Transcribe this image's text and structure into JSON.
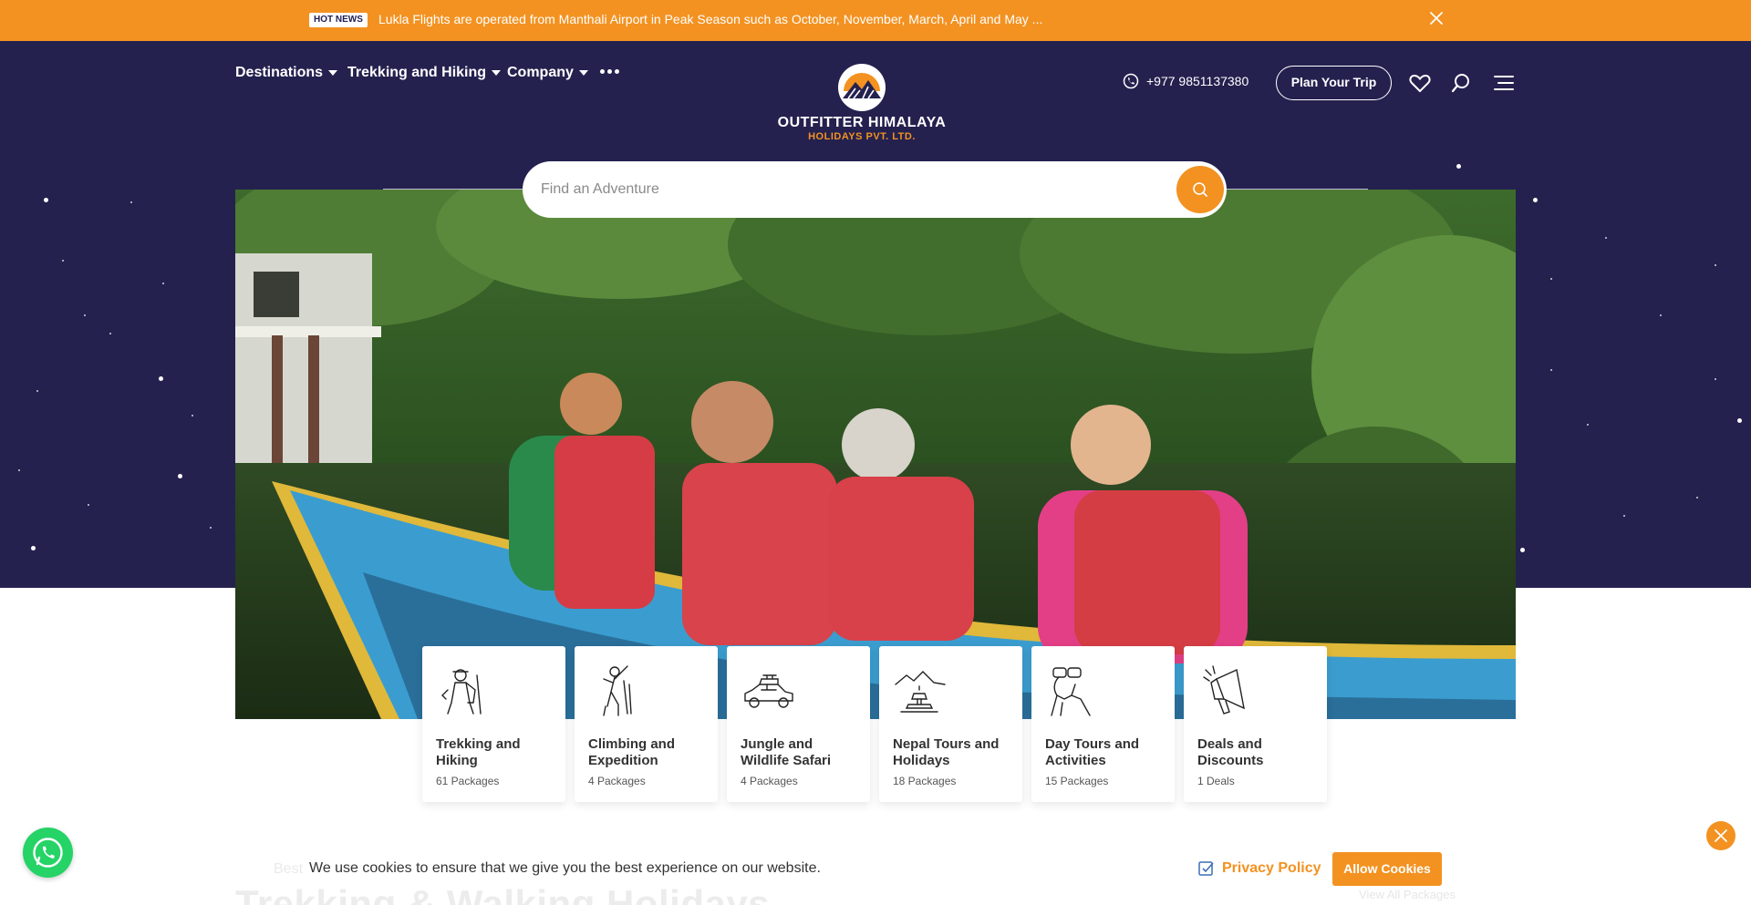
{
  "hot_news": {
    "badge": "HOT NEWS",
    "text": "Lukla Flights are operated from Manthali Airport in Peak Season such as October, November, March, April and May ..."
  },
  "nav": {
    "items": [
      {
        "label": "Destinations"
      },
      {
        "label": "Trekking and Hiking"
      },
      {
        "label": "Company"
      }
    ],
    "more_icon": "more-dots-icon"
  },
  "logo": {
    "name": "OUTFITTER HIMALAYA",
    "sub": "HOLIDAYS PVT. LTD."
  },
  "header": {
    "phone": "+977 9851137380",
    "plan_button": "Plan Your Trip",
    "icons": [
      "whatsapp-icon",
      "heart-icon",
      "search-icon",
      "menu-icon"
    ]
  },
  "search": {
    "placeholder": "Find an Adventure"
  },
  "categories": [
    {
      "title": "Trekking and Hiking",
      "count": "61 Packages",
      "icon": "trekker-icon"
    },
    {
      "title": "Climbing and Expedition",
      "count": "4 Packages",
      "icon": "climber-icon"
    },
    {
      "title": "Jungle and Wildlife Safari",
      "count": "4 Packages",
      "icon": "safari-jeep-icon"
    },
    {
      "title": "Nepal Tours and Holidays",
      "count": "18 Packages",
      "icon": "stupa-icon"
    },
    {
      "title": "Day Tours and Activities",
      "count": "15 Packages",
      "icon": "binoculars-icon"
    },
    {
      "title": "Deals and Discounts",
      "count": "1 Deals",
      "icon": "megaphone-icon"
    }
  ],
  "below": {
    "mini": "Best",
    "title": "Trekking & Walking Holidays",
    "link": "View All Packages"
  },
  "cookie": {
    "text": "We use cookies to ensure that we give you the best experience on our website.",
    "privacy": "Privacy Policy",
    "allow": "Allow Cookies"
  },
  "colors": {
    "accent": "#f39221",
    "navy": "#24214f",
    "whatsapp": "#25d366"
  }
}
